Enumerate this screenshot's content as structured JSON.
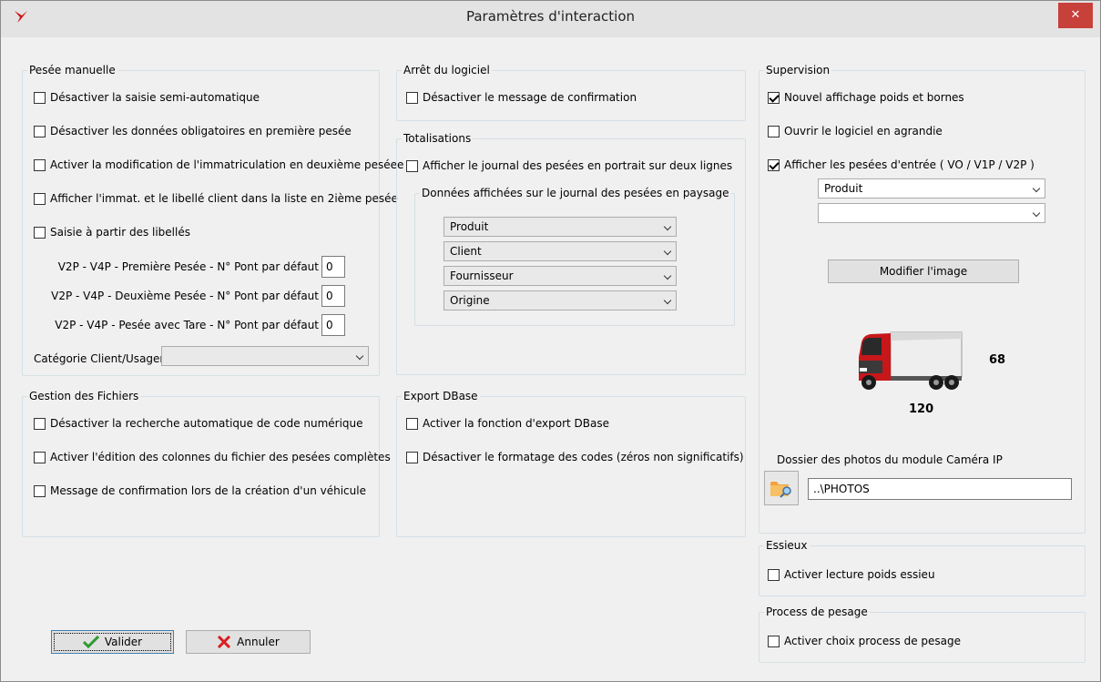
{
  "window": {
    "title": "Paramètres d'interaction",
    "close_glyph": "✕"
  },
  "manual": {
    "title": "Pesée manuelle",
    "options": [
      "Désactiver la saisie semi-automatique",
      "Désactiver les données obligatoires en première pesée",
      "Activer la modification de l'immatriculation en deuxième peséee",
      "Afficher l'immat. et le libellé client dans la liste en 2ième pesée",
      "Saisie à partir des libellés"
    ],
    "checked": [
      false,
      false,
      false,
      false,
      false
    ],
    "defaults": [
      {
        "label": "V2P - V4P - Première Pesée - N° Pont  par défaut",
        "value": "0"
      },
      {
        "label": "V2P - V4P - Deuxième Pesée - N° Pont  par défaut",
        "value": "0"
      },
      {
        "label": "V2P - V4P - Pesée avec Tare - N° Pont  par défaut",
        "value": "0"
      }
    ],
    "category_label": "Catégorie Client/Usager",
    "category_value": ""
  },
  "files": {
    "title": "Gestion des Fichiers",
    "options": [
      "Désactiver la recherche automatique de code numérique",
      "Activer l'édition des colonnes du fichier des pesées complètes",
      "Message de confirmation lors de la création d'un véhicule"
    ],
    "checked": [
      false,
      false,
      false
    ]
  },
  "shutdown": {
    "title": "Arrêt du logiciel",
    "option": "Désactiver le message de confirmation",
    "checked": false
  },
  "totals": {
    "title": "Totalisations",
    "option": "Afficher le journal des pesées en portrait sur deux lignes",
    "checked": false,
    "sub_title": "Données affichées sur le journal des pesées en paysage",
    "combos": [
      "Produit",
      "Client",
      "Fournisseur",
      "Origine"
    ]
  },
  "export": {
    "title": "Export DBase",
    "options": [
      "Activer la fonction d'export DBase",
      "Désactiver le formatage des codes (zéros non significatifs)"
    ],
    "checked": [
      false,
      false
    ]
  },
  "supervision": {
    "title": "Supervision",
    "options": [
      "Nouvel affichage poids et bornes",
      "Ouvrir le logiciel en agrandie",
      "Afficher les pesées d'entrée ( VO / V1P / V2P )"
    ],
    "checked": [
      true,
      false,
      true
    ],
    "combo1": "Produit",
    "combo2": "",
    "modify_button": "Modifier l'image",
    "truck_right_value": "68",
    "truck_bottom_value": "120",
    "photos_label": "Dossier des photos du module Caméra IP",
    "photos_path": "..\\PHOTOS"
  },
  "axles": {
    "title": "Essieux",
    "option": "Activer lecture poids essieu",
    "checked": false
  },
  "process": {
    "title": "Process de pesage",
    "option": "Activer choix process de pesage",
    "checked": false
  },
  "buttons": {
    "ok": "Valider",
    "cancel": "Annuler"
  },
  "colors": {
    "accent_red": "#c7403a",
    "check_green": "#2e9a2e",
    "cancel_red": "#d81e1e",
    "truck_red": "#c8171b"
  }
}
